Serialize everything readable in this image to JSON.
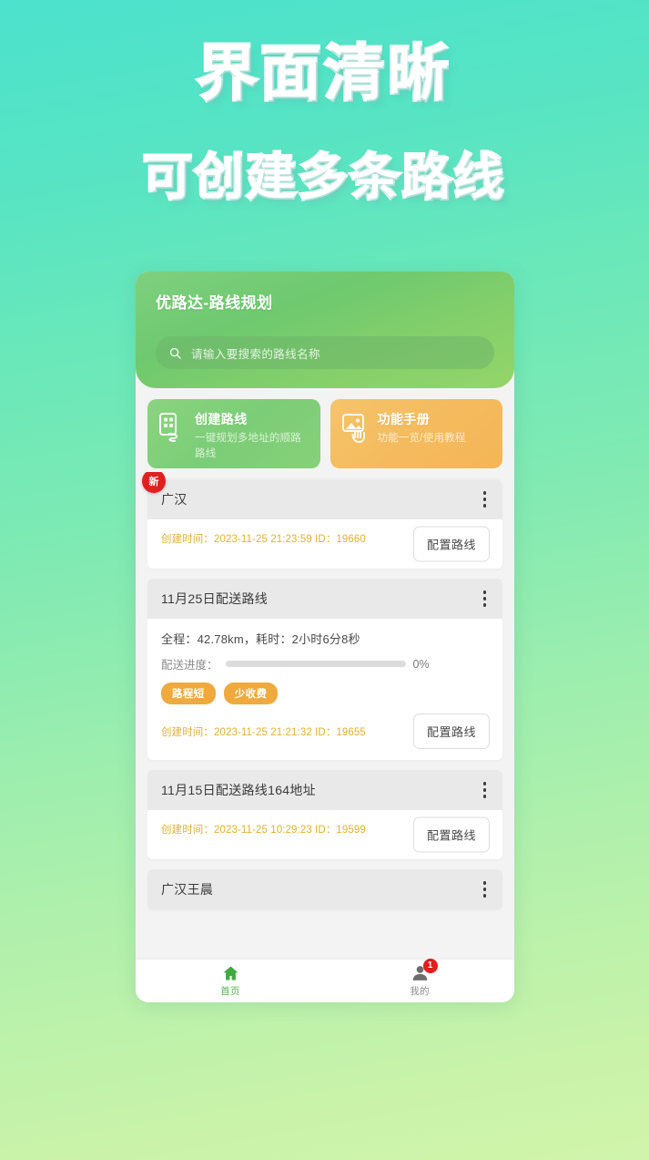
{
  "promo": {
    "line1": "界面清晰",
    "line2": "可创建多条路线"
  },
  "app": {
    "title": "优路达-路线规划",
    "search": {
      "placeholder": "请输入要搜索的路线名称",
      "value": "",
      "icon": "search-icon"
    }
  },
  "actions": [
    {
      "title": "创建路线",
      "subtitle": "一键规划多地址的顺路路线",
      "icon": "building-route-icon",
      "color": "#7ccd77"
    },
    {
      "title": "功能手册",
      "subtitle": "功能一览/使用教程",
      "icon": "manual-image-icon",
      "color": "#f4bb5e"
    }
  ],
  "routes": [
    {
      "name": "广汉",
      "badge": "新",
      "meta": "创建时间：2023-11-25 21:23:59  ID：19660",
      "button": "配置路线",
      "stats": null,
      "progress_label": null,
      "progress_value": null,
      "tags": []
    },
    {
      "name": "11月25日配送路线",
      "badge": null,
      "stats": "全程：42.78km，耗时：2小时6分8秒",
      "progress_label": "配送进度：",
      "progress_value": "0%",
      "tags": [
        "路程短",
        "少收费"
      ],
      "meta": "创建时间：2023-11-25 21:21:32  ID：19655",
      "button": "配置路线"
    },
    {
      "name": "11月15日配送路线164地址",
      "badge": null,
      "stats": null,
      "progress_label": null,
      "progress_value": null,
      "tags": [],
      "meta": "创建时间：2023-11-25 10:29:23  ID：19599",
      "button": "配置路线"
    },
    {
      "name": "广汉王晨",
      "badge": null,
      "stats": null,
      "progress_label": null,
      "progress_value": null,
      "tags": [],
      "meta": null,
      "button": null
    }
  ],
  "bottom_nav": [
    {
      "label": "首页",
      "icon": "home-icon",
      "active": true,
      "badge": null
    },
    {
      "label": "我的",
      "icon": "user-icon",
      "active": false,
      "badge": "1"
    }
  ],
  "colors": {
    "bg_top": "#4ce2cd",
    "bg_bottom": "#d0f4ab",
    "header_green": "#7ccd77",
    "accent_orange": "#f0a93c",
    "meta_gold": "#e3b02e",
    "badge_red": "#e01f1f",
    "nav_active": "#55b64f"
  }
}
